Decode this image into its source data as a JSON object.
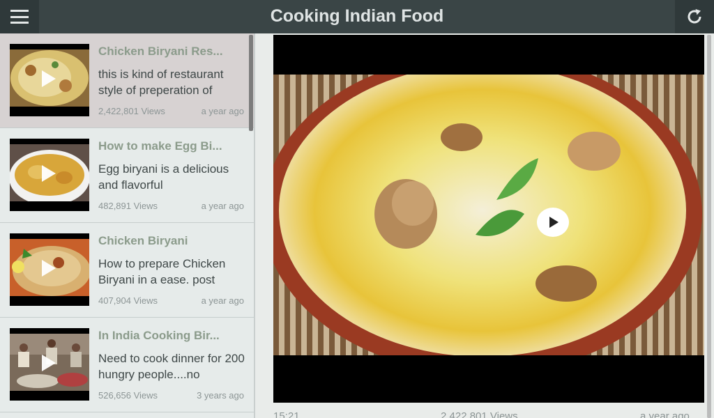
{
  "app": {
    "title": "Cooking Indian Food",
    "menu_icon": "hamburger-menu-icon",
    "refresh_icon": "refresh-icon",
    "colors": {
      "topbar": "#3a4546",
      "title": "#dfe4e4",
      "item_title": "#8b9b8b",
      "item_desc": "#3e4747",
      "muted": "#8c9595"
    }
  },
  "videos": [
    {
      "title": "Chicken Biryani Res...",
      "desc": "this is kind of restaurant style of preperation of",
      "views": "2,422,801 Views",
      "date": "a year ago",
      "selected": true
    },
    {
      "title": "How to make Egg Bi...",
      "desc": "Egg biryani is a delicious and flavorful",
      "views": "482,891 Views",
      "date": "a year ago",
      "selected": false
    },
    {
      "title": "Chicken Biryani",
      "desc": "How to prepare Chicken Biryani in a ease. post",
      "views": "407,904 Views",
      "date": "a year ago",
      "selected": false
    },
    {
      "title": "In India Cooking Bir...",
      "desc": "Need to cook dinner for 200 hungry people....no",
      "views": "526,656 Views",
      "date": "3 years ago",
      "selected": false
    }
  ],
  "player": {
    "duration": "15:21",
    "views": "2,422,801 Views",
    "date": "a year ago",
    "play_icon": "play-icon"
  }
}
